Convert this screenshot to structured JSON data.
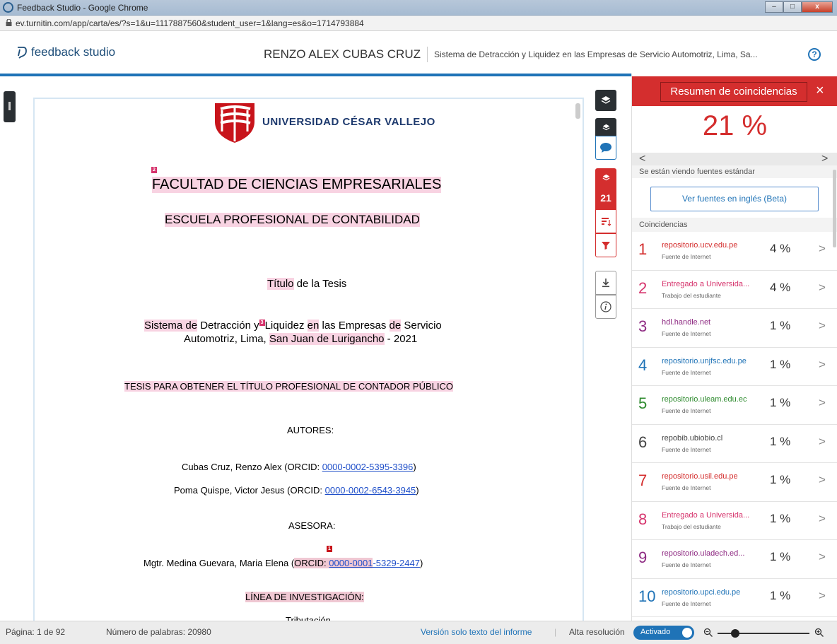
{
  "window": {
    "title": "Feedback Studio - Google Chrome",
    "url": "ev.turnitin.com/app/carta/es/?s=1&u=1117887560&student_user=1&lang=es&o=1714793884"
  },
  "header": {
    "logo_text": "feedback studio",
    "author": "RENZO ALEX CUBAS CRUZ",
    "doc_title": "Sistema de Detracción y Liquidez en las Empresas de Servicio Automotriz, Lima, Sa...",
    "help": "?"
  },
  "document": {
    "university": "UNIVERSIDAD CÉSAR VALLEJO",
    "marker_2": "2",
    "marker_1": "1",
    "marker_3": "3",
    "faculty": "FACULTAD DE CIENCIAS EMPRESARIALES",
    "school": "ESCUELA PROFESIONAL DE CONTABILIDAD",
    "thesis_title_word": "Título",
    "thesis_title_rest": " de la Tesis",
    "title_line1": {
      "a": "Sistema de",
      "b": " Detracción y",
      "c": "Liquidez",
      "d": " ",
      "e": "en",
      "f": " las Empresas ",
      "g": "de",
      "h": " Servicio"
    },
    "title_line2": {
      "a": "Automotriz, Lima, ",
      "b": "San Juan de Lurigancho",
      "c": " - 2021"
    },
    "degree": "TESIS PARA OBTENER EL TÍTULO PROFESIONAL DE CONTADOR PÚBLICO",
    "authors_heading": "AUTORES:",
    "author1_text": "Cubas Cruz, Renzo Alex (ORCID: ",
    "author1_orcid": "0000-0002-5395-3396",
    "author2_text": "Poma Quispe, Victor Jesus (ORCID: ",
    "author2_orcid": "0000-0002-6543-3945",
    "close_paren": ")",
    "advisor_heading": "ASESORA:",
    "advisor_text": "Mgtr. Medina Guevara, Maria Elena (",
    "advisor_orcid_label": "ORCID: ",
    "advisor_orcid_a": "0000-0001",
    "advisor_orcid_b": "-5329-2447",
    "research_line": "LÍNEA DE INVESTIGACIÓN:",
    "research_topic": "Tributación"
  },
  "tools": {
    "match_count": "21"
  },
  "panel": {
    "title": "Resumen de coincidencias",
    "close": "×",
    "overall_pct": "21 %",
    "prev": "<",
    "next": ">",
    "viewing_sources": "Se están viendo fuentes estándar",
    "english_sources_button": "Ver fuentes en inglés (Beta)",
    "matches_heading": "Coincidencias",
    "matches": [
      {
        "num": "1",
        "source": "repositorio.ucv.edu.pe",
        "type": "Fuente de Internet",
        "pct": "4 %",
        "color": "#d42e2e"
      },
      {
        "num": "2",
        "source": "Entregado a Universida...",
        "type": "Trabajo del estudiante",
        "pct": "4 %",
        "color": "#d6336c"
      },
      {
        "num": "3",
        "source": "hdl.handle.net",
        "type": "Fuente de Internet",
        "pct": "1 %",
        "color": "#8e2a82"
      },
      {
        "num": "4",
        "source": "repositorio.unjfsc.edu.pe",
        "type": "Fuente de Internet",
        "pct": "1 %",
        "color": "#1f73b7"
      },
      {
        "num": "5",
        "source": "repositorio.uleam.edu.ec",
        "type": "Fuente de Internet",
        "pct": "1 %",
        "color": "#2d8a2d"
      },
      {
        "num": "6",
        "source": "repobib.ubiobio.cl",
        "type": "Fuente de Internet",
        "pct": "1 %",
        "color": "#444444"
      },
      {
        "num": "7",
        "source": "repositorio.usil.edu.pe",
        "type": "Fuente de Internet",
        "pct": "1 %",
        "color": "#d42e2e"
      },
      {
        "num": "8",
        "source": "Entregado a Universida...",
        "type": "Trabajo del estudiante",
        "pct": "1 %",
        "color": "#d6336c"
      },
      {
        "num": "9",
        "source": "repositorio.uladech.ed...",
        "type": "Fuente de Internet",
        "pct": "1 %",
        "color": "#8e2a82"
      },
      {
        "num": "10",
        "source": "repositorio.upci.edu.pe",
        "type": "Fuente de Internet",
        "pct": "1 %",
        "color": "#1f73b7"
      }
    ]
  },
  "status": {
    "page": "Página: 1 de 92",
    "words": "Número de palabras: 20980",
    "text_only": "Versión solo texto del informe",
    "high_res_label": "Alta resolución",
    "toggle_state": "Activado"
  },
  "colors": {
    "accent": "#1f73b7",
    "turnitin_red": "#d42e2e",
    "highlight_pink": "#f8d3e2"
  }
}
